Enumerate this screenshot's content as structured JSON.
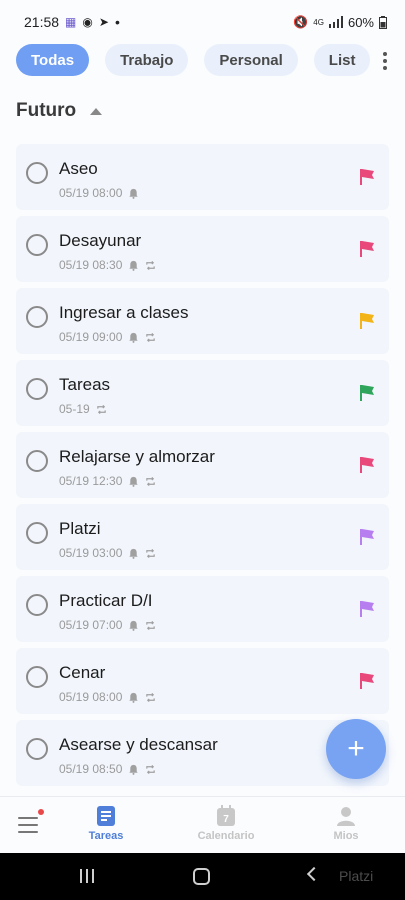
{
  "status_bar": {
    "time": "21:58",
    "notif_icons": [
      "calendar-app-icon",
      "spy-icon",
      "telegram-icon"
    ],
    "dot": "•",
    "network": "4G",
    "battery": "60%"
  },
  "filters": {
    "chips": [
      {
        "label": "Todas",
        "active": true
      },
      {
        "label": "Trabajo",
        "active": false
      },
      {
        "label": "Personal",
        "active": false
      },
      {
        "label": "List",
        "active": false
      }
    ]
  },
  "section": {
    "title": "Futuro"
  },
  "tasks": [
    {
      "title": "Aseo",
      "datetime": "05/19 08:00",
      "reminder": true,
      "repeat": false,
      "flag_color": "#e8487a"
    },
    {
      "title": "Desayunar",
      "datetime": "05/19 08:30",
      "reminder": true,
      "repeat": true,
      "flag_color": "#e8487a"
    },
    {
      "title": "Ingresar a clases",
      "datetime": "05/19 09:00",
      "reminder": true,
      "repeat": true,
      "flag_color": "#f2b418"
    },
    {
      "title": "Tareas",
      "datetime": "05-19",
      "reminder": false,
      "repeat": true,
      "flag_color": "#2ea55a"
    },
    {
      "title": "Relajarse y almorzar",
      "datetime": "05/19 12:30",
      "reminder": true,
      "repeat": true,
      "flag_color": "#e8487a"
    },
    {
      "title": "Platzi",
      "datetime": "05/19 03:00",
      "reminder": true,
      "repeat": true,
      "flag_color": "#b77ef0"
    },
    {
      "title": "Practicar D/I",
      "datetime": "05/19 07:00",
      "reminder": true,
      "repeat": true,
      "flag_color": "#b77ef0"
    },
    {
      "title": "Cenar",
      "datetime": "05/19 08:00",
      "reminder": true,
      "repeat": true,
      "flag_color": "#e8487a"
    },
    {
      "title": "Asearse y descansar",
      "datetime": "05/19 08:50",
      "reminder": true,
      "repeat": true,
      "flag_color": "#e8487a"
    }
  ],
  "fab": {
    "symbol": "+"
  },
  "bottom_nav": {
    "tasks_label": "Tareas",
    "calendar_label": "Calendario",
    "calendar_day": "7",
    "mine_label": "Mios"
  },
  "colors": {
    "accent": "#6f9ef3",
    "active_tab": "#4f7fd9",
    "card_bg": "#f2f6fc"
  },
  "watermark": "Platzi"
}
